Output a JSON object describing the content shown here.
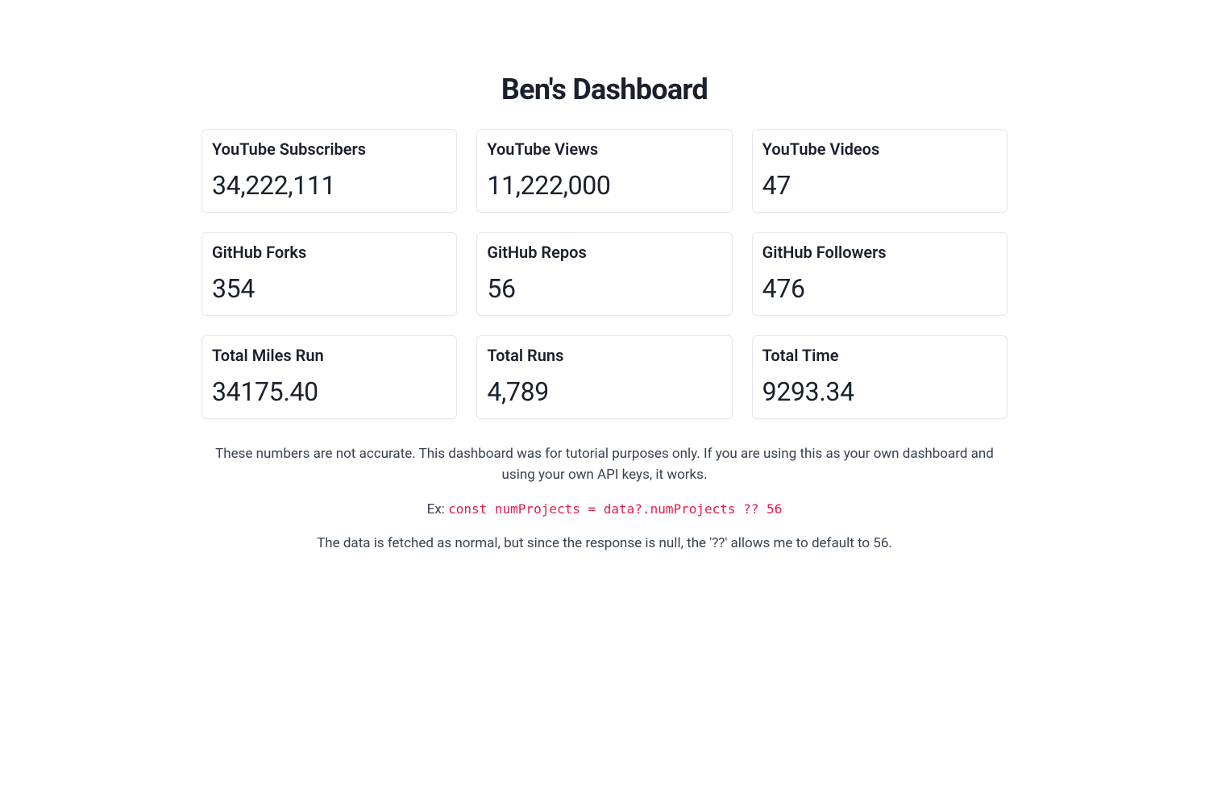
{
  "header": {
    "title": "Ben's Dashboard"
  },
  "cards": [
    {
      "label": "YouTube Subscribers",
      "value": "34,222,111"
    },
    {
      "label": "YouTube Views",
      "value": "11,222,000"
    },
    {
      "label": "YouTube Videos",
      "value": "47"
    },
    {
      "label": "GitHub Forks",
      "value": "354"
    },
    {
      "label": "GitHub Repos",
      "value": "56"
    },
    {
      "label": "GitHub Followers",
      "value": "476"
    },
    {
      "label": "Total Miles Run",
      "value": "34175.40"
    },
    {
      "label": "Total Runs",
      "value": "4,789"
    },
    {
      "label": "Total Time",
      "value": "9293.34"
    }
  ],
  "notes": {
    "disclaimer": "These numbers are not accurate. This dashboard was for tutorial purposes only. If you are using this as your own dashboard and using your own API keys, it works.",
    "example_prefix": "Ex: ",
    "example_code": "const numProjects = data?.numProjects ?? 56",
    "explanation": "The data is fetched as normal, but since the response is null, the '??' allows me to default to 56."
  }
}
